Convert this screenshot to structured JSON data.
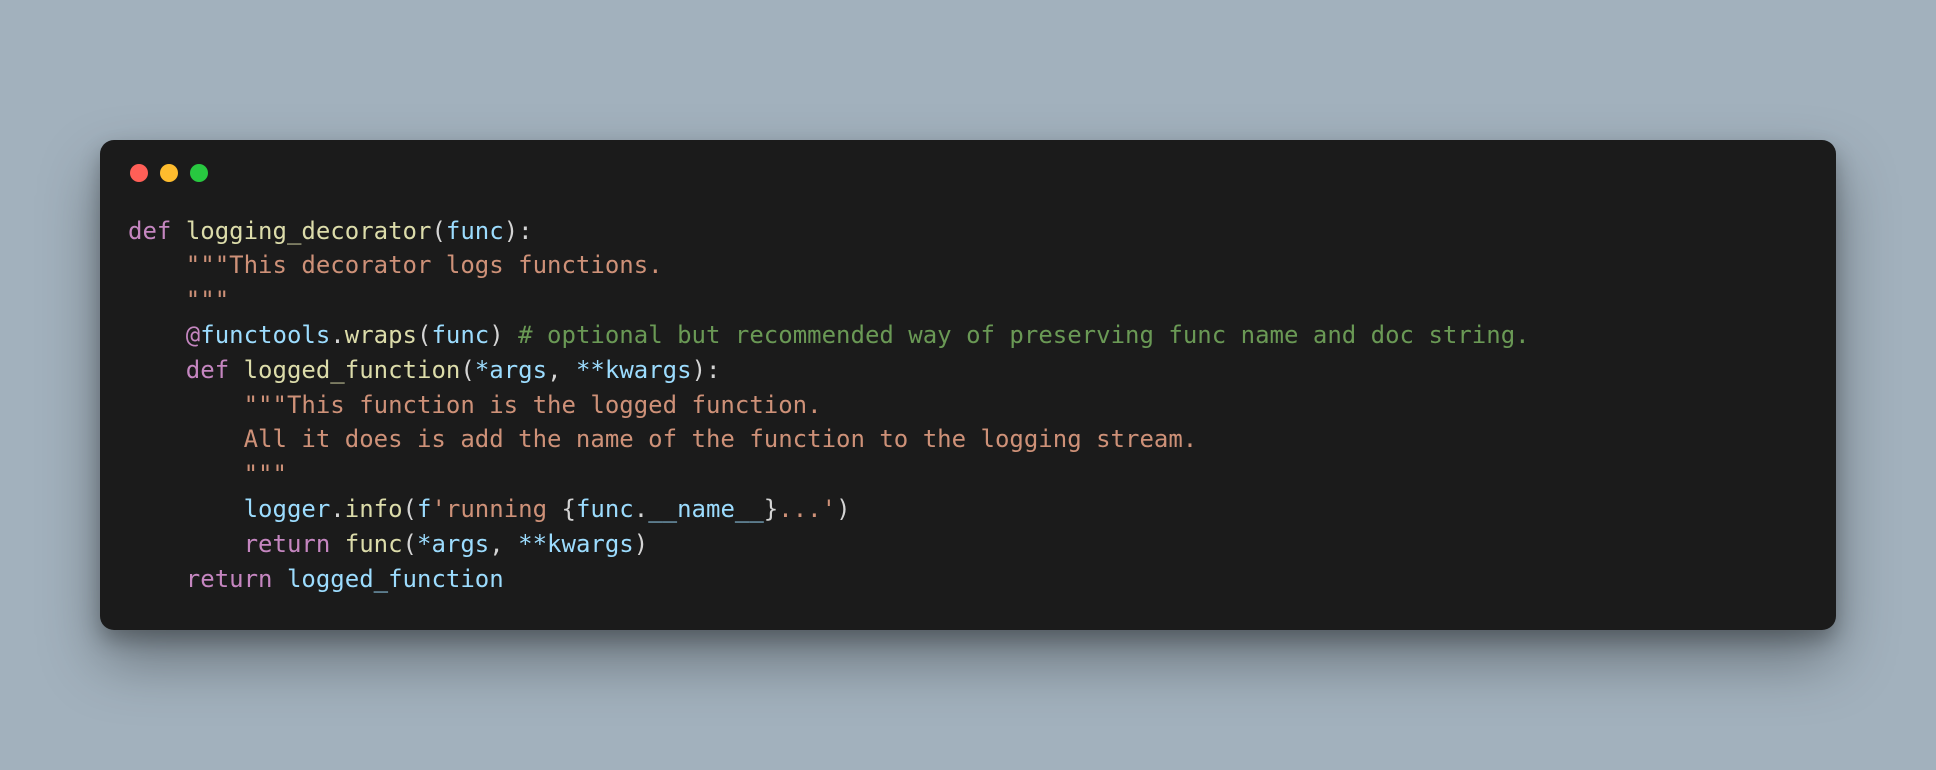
{
  "window": {
    "traffic_lights": [
      "close",
      "minimize",
      "zoom"
    ]
  },
  "code": {
    "l1": {
      "kw_def": "def",
      "fn": "logging_decorator",
      "open": "(",
      "param": "func",
      "close": "):"
    },
    "l2": {
      "doc": "\"\"\"This decorator logs functions."
    },
    "l3": {
      "doc": "\"\"\""
    },
    "l4": {
      "at": "@",
      "mod": "functools",
      "dot": ".",
      "wraps": "wraps",
      "open": "(",
      "arg": "func",
      "close": ")",
      "comment": "# optional but recommended way of preserving func name and doc string."
    },
    "l5": {
      "kw_def": "def",
      "fn": "logged_function",
      "open": "(",
      "star_args": "*args",
      "comma": ", ",
      "star_kwargs": "**kwargs",
      "close": "):"
    },
    "l6": {
      "doc": "\"\"\"This function is the logged function."
    },
    "l7": {
      "doc": "All it does is add the name of the function to the logging stream."
    },
    "l8": {
      "doc": "\"\"\""
    },
    "l9": {
      "obj": "logger",
      "dot": ".",
      "method": "info",
      "open": "(",
      "f_prefix": "f",
      "str_open": "'",
      "str_part1": "running ",
      "brace_open": "{",
      "expr_obj": "func",
      "expr_dot": ".",
      "expr_attr": "__name__",
      "brace_close": "}",
      "str_part2": "...",
      "str_close": "'",
      "close": ")"
    },
    "l10": {
      "kw_return": "return",
      "fn": "func",
      "open": "(",
      "star_args": "*args",
      "comma": ", ",
      "star_kwargs": "**kwargs",
      "close": ")"
    },
    "l11": {
      "kw_return": "return",
      "ident": "logged_function"
    }
  }
}
